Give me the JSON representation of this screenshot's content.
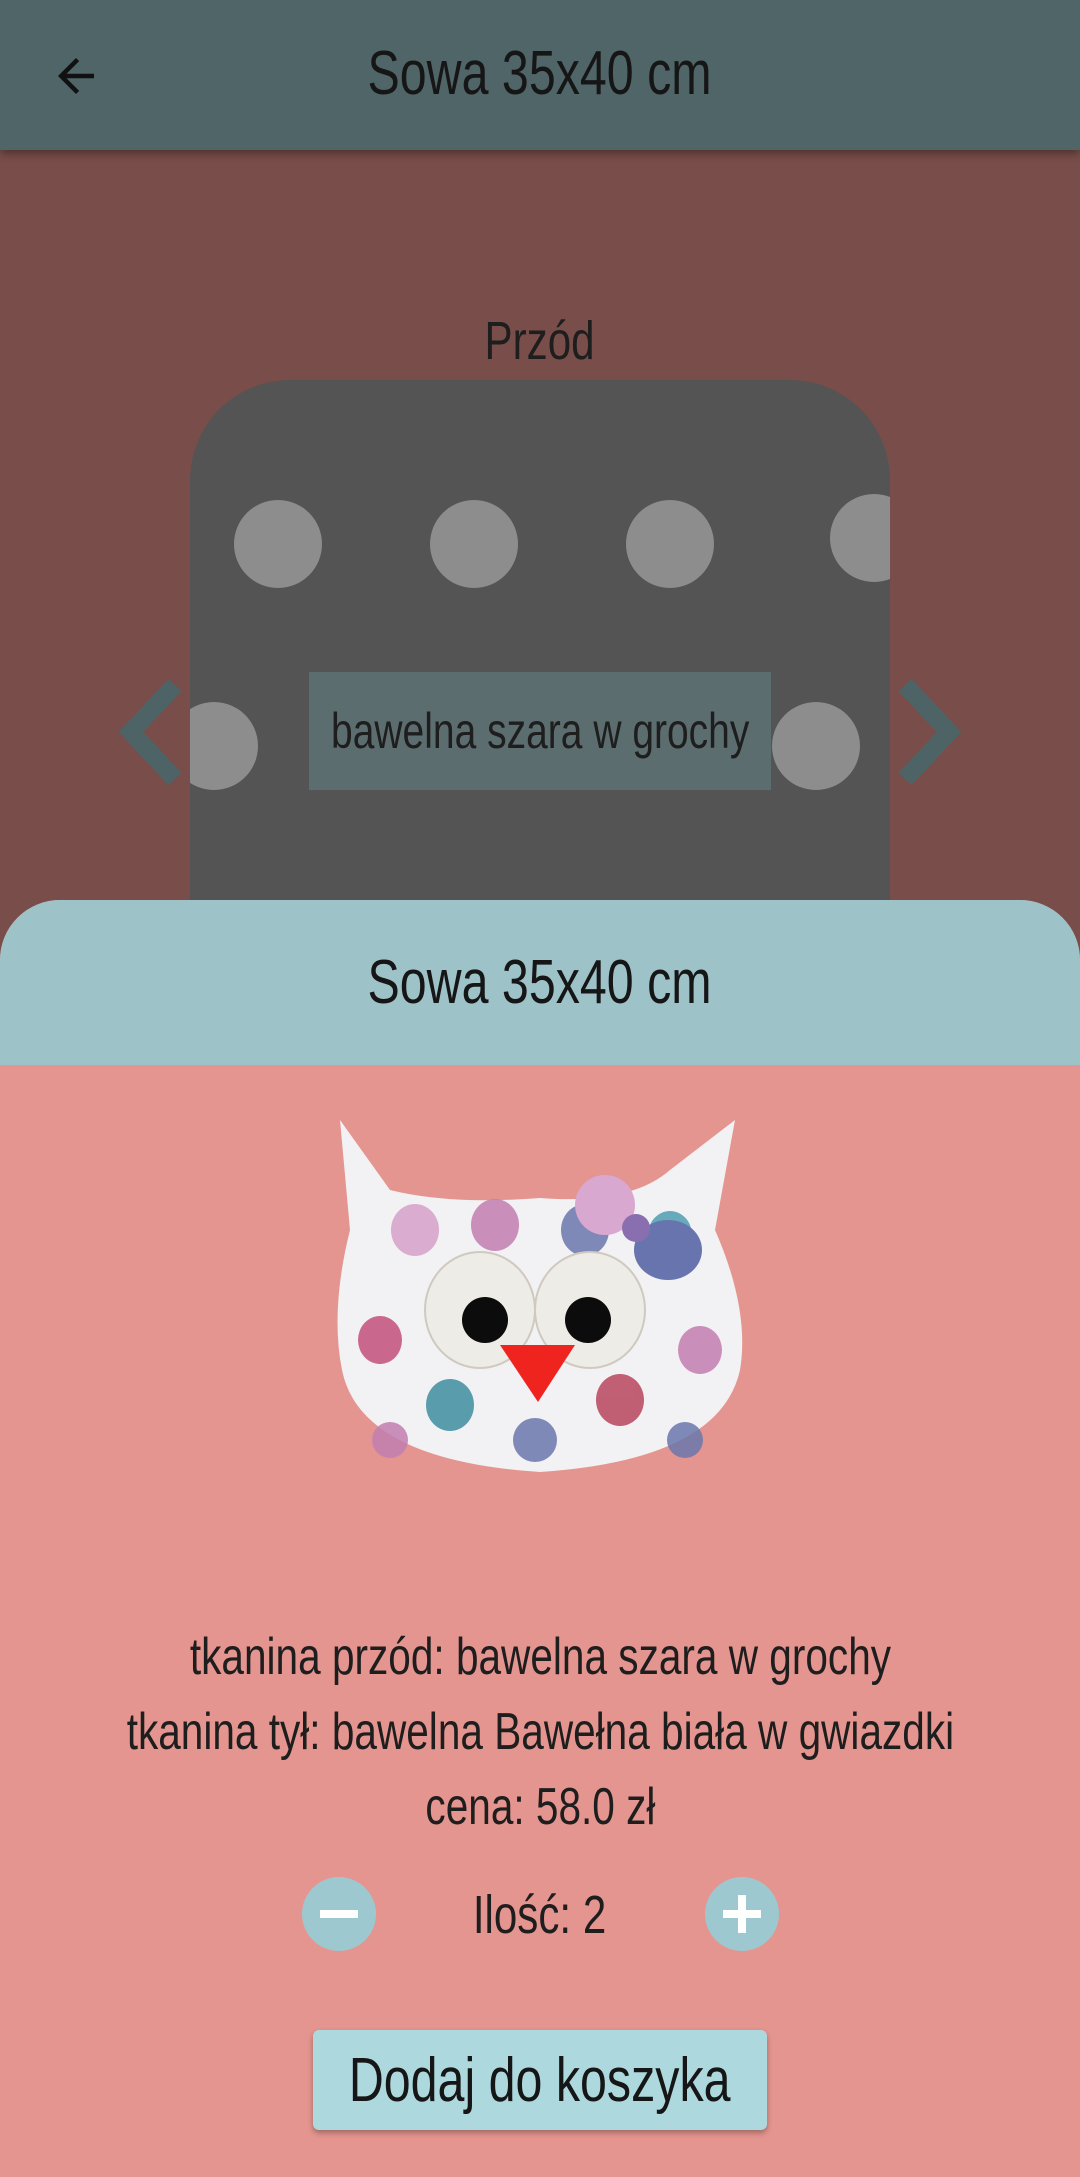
{
  "app_bar": {
    "title": "Sowa 35x40 cm",
    "back_icon": "arrow-left-icon"
  },
  "fabric_preview": {
    "side_label": "Przód",
    "fabric_name": "bawelna szara w grochy",
    "prev_icon": "chevron-left-icon",
    "next_icon": "chevron-right-icon"
  },
  "sheet": {
    "title": "Sowa 35x40 cm",
    "front_fabric": "tkanina przód: bawelna szara w grochy",
    "back_fabric": "tkanina tył: bawelna Bawełna biała w gwiazdki",
    "price": "cena: 58.0 zł",
    "quantity_label": "Ilość: 2",
    "decrease_icon": "minus-icon",
    "increase_icon": "plus-icon",
    "add_to_cart": "Dodaj do koszyka"
  },
  "colors": {
    "app_bar": "#4f6568",
    "background": "#794e4a",
    "sheet_header": "#9dc3c9",
    "sheet_body": "#e5958f",
    "button": "#add8de"
  }
}
